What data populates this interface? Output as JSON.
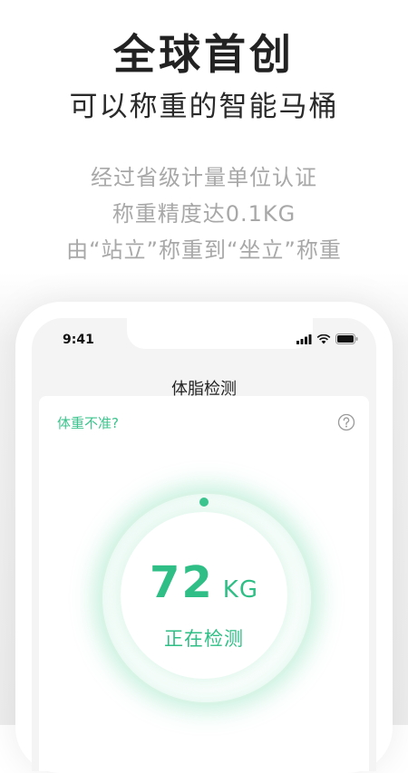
{
  "headline": {
    "title": "全球首创",
    "subtitle": "可以称重的智能马桶",
    "desc_lines": [
      "经过省级计量单位认证",
      "称重精度达0.1KG",
      "由“站立”称重到“坐立”称重"
    ]
  },
  "phone": {
    "status_time": "9:41",
    "page_title": "体脂检测",
    "card": {
      "inaccurate_link": "体重不准?",
      "weight_value": "72",
      "weight_unit": "KG",
      "status": "正在检测"
    }
  },
  "colors": {
    "accent": "#3cc48e",
    "title_text": "#222222",
    "muted_text": "#a8a8a8"
  },
  "icons": [
    "signal-icon",
    "wifi-icon",
    "battery-icon",
    "help-icon"
  ]
}
